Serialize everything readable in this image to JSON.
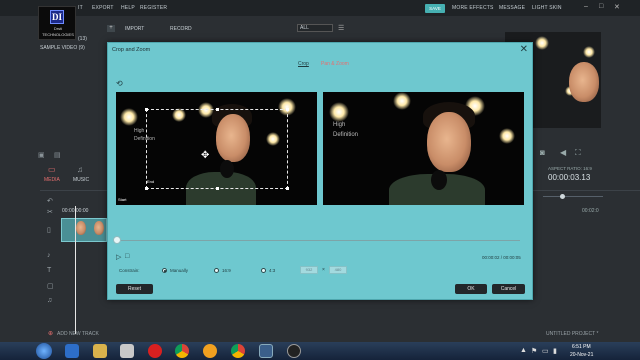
{
  "menubar": {
    "items": [
      "IT",
      "EXPORT",
      "HELP",
      "REGISTER"
    ],
    "save": "SAVE",
    "right_items": [
      "MORE EFFECTS",
      "MESSAGE",
      "LIGHT SKIN"
    ]
  },
  "logo": {
    "mark": "DI",
    "line1": "Drsti",
    "line2": "TECHNOLOGIES"
  },
  "library": {
    "count": "(13)",
    "sample_video": "SAMPLE VIDEO (9)"
  },
  "toolbar": {
    "import": "IMPORT",
    "record": "RECORD",
    "filter": "ALL"
  },
  "tabs": {
    "media": "MEDIA",
    "music": "MUSIC"
  },
  "timeline": {
    "start_time": "00:00:00:00",
    "ruler_right": "00:02:0",
    "add_track": "ADD NEW TRACK"
  },
  "right_panel": {
    "aspect": "ASPECT RATIO: 16:9",
    "timecode": "00:00:03.13"
  },
  "project_name": "UNTITLED PROJECT *",
  "dialog": {
    "title": "Crop and Zoom",
    "tabs": [
      "Crop",
      "Pan & Zoom"
    ],
    "overlay_text": [
      "High",
      "Definition"
    ],
    "start_label": "Start",
    "end_label": "End",
    "time": "00:00:02 / 00:00:05",
    "constrain_label": "Constrain:",
    "options": [
      "Manually",
      "16:9",
      "4:3"
    ],
    "width": "932",
    "height": "480",
    "times": "×",
    "reset": "Reset",
    "ok": "OK",
    "cancel": "Cancel"
  },
  "taskbar": {
    "time": "6:51 PM",
    "date": "20-Nov-21"
  },
  "colors": {
    "dialog_bg": "#6ec8cf",
    "accent": "#46b0b2",
    "tab_active": "#e76f6f"
  }
}
